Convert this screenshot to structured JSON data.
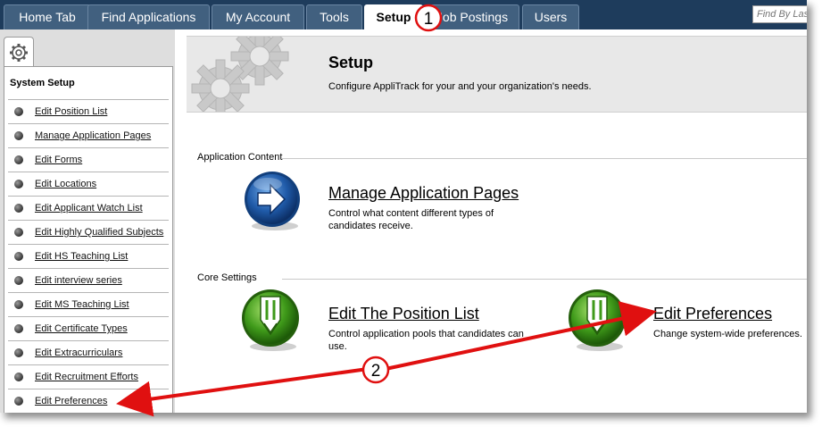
{
  "tabs": [
    {
      "label": "Home Tab"
    },
    {
      "label": "Find Applications"
    },
    {
      "label": "My Account"
    },
    {
      "label": "Tools"
    },
    {
      "label": "Setup"
    },
    {
      "label": "Job Postings"
    },
    {
      "label": "Users"
    }
  ],
  "search": {
    "placeholder": "Find By Last Name"
  },
  "sidebar": {
    "title": "System Setup",
    "items": [
      {
        "label": "Edit Position List"
      },
      {
        "label": "Manage Application Pages"
      },
      {
        "label": "Edit Forms"
      },
      {
        "label": "Edit Locations"
      },
      {
        "label": "Edit Applicant Watch List"
      },
      {
        "label": "Edit Highly Qualified Subjects"
      },
      {
        "label": "Edit HS Teaching List"
      },
      {
        "label": "Edit interview series"
      },
      {
        "label": "Edit MS Teaching List"
      },
      {
        "label": "Edit Certificate Types"
      },
      {
        "label": "Edit Extracurriculars"
      },
      {
        "label": "Edit Recruitment Efforts"
      },
      {
        "label": "Edit Preferences"
      }
    ]
  },
  "header": {
    "title": "Setup",
    "subtitle": "Configure AppliTrack for your and your organization's needs."
  },
  "sections": {
    "application_content": {
      "label": "Application Content",
      "manage_pages": {
        "title": "Manage Application Pages",
        "desc_line1": "Control what content different types of",
        "desc_line2": "candidates receive."
      }
    },
    "core_settings": {
      "label": "Core Settings",
      "position_list": {
        "title": "Edit The Position List",
        "desc_line1": "Control application pools that candidates can",
        "desc_line2": "use."
      },
      "preferences": {
        "title": "Edit Preferences",
        "desc": "Change system-wide preferences."
      }
    }
  },
  "callouts": [
    {
      "label": "1"
    },
    {
      "label": "2"
    }
  ],
  "colors": {
    "tabbar": "#1e3c5c",
    "tab": "#41607f",
    "callout_red": "#e01010",
    "icon_green": "#3f9a1a",
    "icon_blue": "#1f5aa8"
  }
}
